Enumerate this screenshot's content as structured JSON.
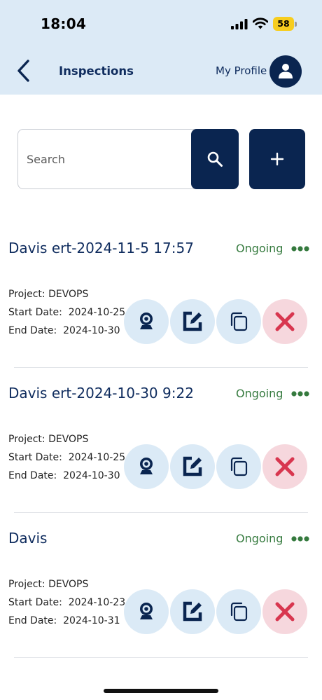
{
  "status_bar": {
    "time": "18:04",
    "battery": "58"
  },
  "header": {
    "title": "Inspections",
    "profile_label": "My Profile"
  },
  "search": {
    "placeholder": "Search"
  },
  "colors": {
    "navy": "#0a2550",
    "header_bg": "#dceaf6",
    "status_green": "#357a3e",
    "delete_red": "#d8364f",
    "action_blue_bg": "#dbeaf6",
    "action_red_bg": "#f6d7dd"
  },
  "icons": {
    "back": "chevron-left-icon",
    "avatar": "person-icon",
    "search": "magnifier-icon",
    "add": "plus-icon",
    "more": "ellipsis-icon",
    "camera": "webcam-icon",
    "edit": "edit-square-icon",
    "copy": "copy-icon",
    "delete": "x-icon"
  },
  "inspections": [
    {
      "title": "Davis ert-2024-11-5 17:57",
      "status": "Ongoing",
      "project_label": "Project:",
      "project": "DEVOPS",
      "start_label": "Start Date:",
      "start": "2024-10-25",
      "end_label": "End Date:",
      "end": "2024-10-30"
    },
    {
      "title": "Davis ert-2024-10-30 9:22",
      "status": "Ongoing",
      "project_label": "Project:",
      "project": "DEVOPS",
      "start_label": "Start Date:",
      "start": "2024-10-25",
      "end_label": "End Date:",
      "end": "2024-10-30"
    },
    {
      "title": "Davis",
      "status": "Ongoing",
      "project_label": "Project:",
      "project": "DEVOPS",
      "start_label": "Start Date:",
      "start": "2024-10-23",
      "end_label": "End Date:",
      "end": "2024-10-31"
    }
  ]
}
